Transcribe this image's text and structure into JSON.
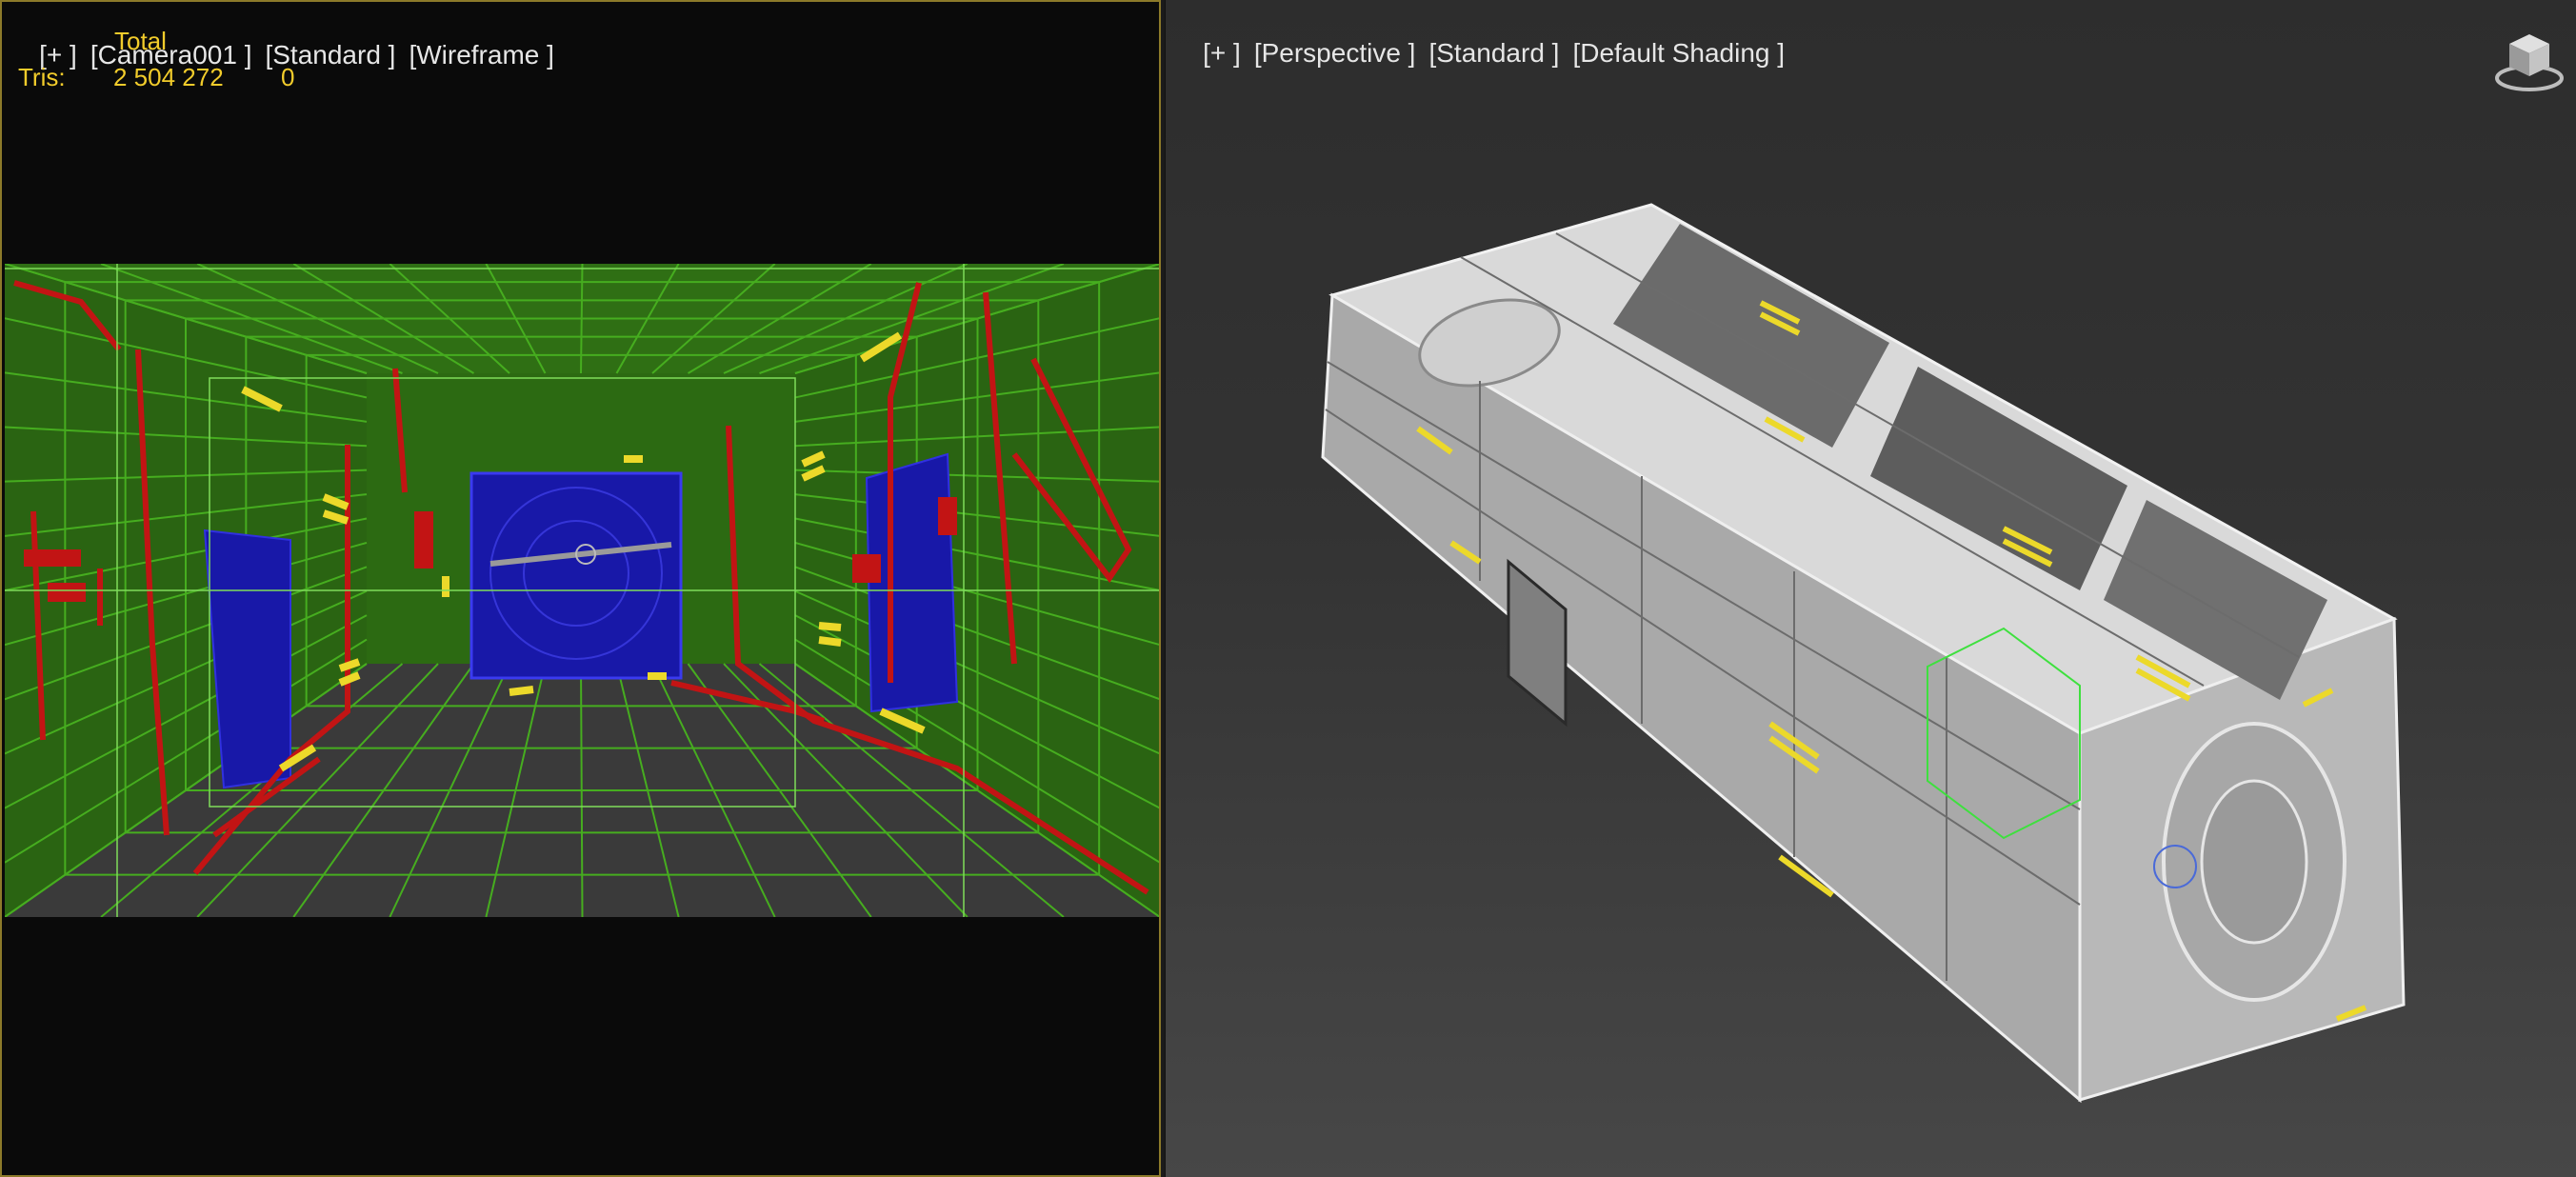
{
  "colors": {
    "wire_green": "#3f9e1c",
    "wire_red": "#c21414",
    "wire_blue": "#1818a8",
    "stats_yellow": "#f2cc2b",
    "viewport_border_active": "#8c7a2a",
    "light_yellow": "#ecd92a"
  },
  "viewports": {
    "left": {
      "labels": [
        "[+ ]",
        "[Camera001 ]",
        "[Standard ]",
        "[Wireframe ]"
      ],
      "stats": {
        "header": "Total",
        "row_label": "Tris:",
        "total": "2 504 272",
        "selected": "0"
      }
    },
    "right": {
      "labels": [
        "[+ ]",
        "[Perspective ]",
        "[Standard ]",
        "[Default Shading ]"
      ]
    }
  },
  "icons": {
    "viewcube": "viewcube-icon"
  }
}
